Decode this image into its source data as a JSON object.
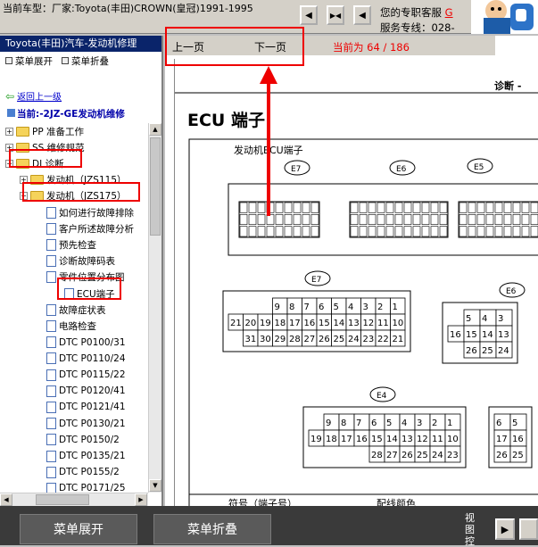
{
  "header": {
    "car_model": "当前车型：厂家:Toyota(丰田)CROWN(皇冠)1991-1995",
    "service_line1_a": "您的专职客服",
    "service_line1_b": "G",
    "service_line2": "服务专线：028-"
  },
  "sidebar": {
    "title": "Toyota(丰田)汽车-发动机修理",
    "expand": "菜单展开",
    "collapse": "菜单折叠",
    "back": "返回上一级",
    "current": "当前:-2JZ-GE发动机维修",
    "items": [
      {
        "label": "PP 准备工作",
        "type": "folder",
        "sign": "+"
      },
      {
        "label": "SS 维修规范",
        "type": "folder",
        "sign": "+"
      },
      {
        "label": "DI 诊断",
        "type": "folder",
        "sign": "−"
      },
      {
        "label": "发动机（JZS115）",
        "type": "folder",
        "sign": "+"
      },
      {
        "label": "发动机（JZS175）",
        "type": "folder",
        "sign": "−"
      },
      {
        "label": "如何进行故障排除",
        "type": "doc"
      },
      {
        "label": "客户所述故障分析",
        "type": "doc"
      },
      {
        "label": "预先检查",
        "type": "doc"
      },
      {
        "label": "诊断故障码表",
        "type": "doc"
      },
      {
        "label": "零件位置分布图",
        "type": "doc"
      },
      {
        "label": "ECU端子",
        "type": "doc"
      },
      {
        "label": "故障症状表",
        "type": "doc"
      },
      {
        "label": "电路检查",
        "type": "doc"
      },
      {
        "label": "DTC P0100/31",
        "type": "doc"
      },
      {
        "label": "DTC P0110/24",
        "type": "doc"
      },
      {
        "label": "DTC P0115/22",
        "type": "doc"
      },
      {
        "label": "DTC P0120/41",
        "type": "doc"
      },
      {
        "label": "DTC P0121/41",
        "type": "doc"
      },
      {
        "label": "DTC P0130/21",
        "type": "doc"
      },
      {
        "label": "DTC P0150/2",
        "type": "doc"
      },
      {
        "label": "DTC P0135/21",
        "type": "doc"
      },
      {
        "label": "DTC P0155/2",
        "type": "doc"
      },
      {
        "label": "DTC P0171/25",
        "type": "doc"
      }
    ]
  },
  "toolbar": {
    "prev": "上一页",
    "next": "下一页",
    "page": "当前为 64 / 186"
  },
  "document": {
    "header_right": "诊断 -",
    "title": "ECU 端子",
    "subtitle": "发动机ECU端子",
    "conn_e7": "E7",
    "conn_e6": "E6",
    "conn_e5": "E5",
    "conn_e4": "E4",
    "table_col1": "符号（端子号）",
    "table_col2": "配线颜色",
    "e7_row1": [
      "9",
      "8",
      "7",
      "6",
      "5",
      "4",
      "3",
      "2",
      "1"
    ],
    "e7_row2": [
      "21",
      "20",
      "19",
      "18",
      "17",
      "16",
      "15",
      "14",
      "13",
      "12",
      "11",
      "10"
    ],
    "e7_row3": [
      "31",
      "30",
      "29",
      "28",
      "27",
      "26",
      "25",
      "24",
      "23",
      "22",
      "21"
    ],
    "e6_row1": [
      "5",
      "4",
      "3"
    ],
    "e6_row2": [
      "16",
      "15",
      "14",
      "13"
    ],
    "e6_row3": [
      "26",
      "25",
      "24"
    ],
    "e4_row1": [
      "9",
      "8",
      "7",
      "6",
      "5",
      "4",
      "3",
      "2",
      "1"
    ],
    "e4_row2": [
      "19",
      "18",
      "17",
      "16",
      "15",
      "14",
      "13",
      "12",
      "11",
      "10"
    ],
    "e4_row3": [
      "28",
      "27",
      "26",
      "25",
      "24",
      "23"
    ],
    "e3_row1": [
      "6",
      "5"
    ],
    "e3_row2": [
      "17",
      "16"
    ],
    "e3_row3": [
      "26",
      "25"
    ]
  },
  "bottombar": {
    "expand": "菜单展开",
    "collapse": "菜单折叠",
    "view": "视图控"
  }
}
